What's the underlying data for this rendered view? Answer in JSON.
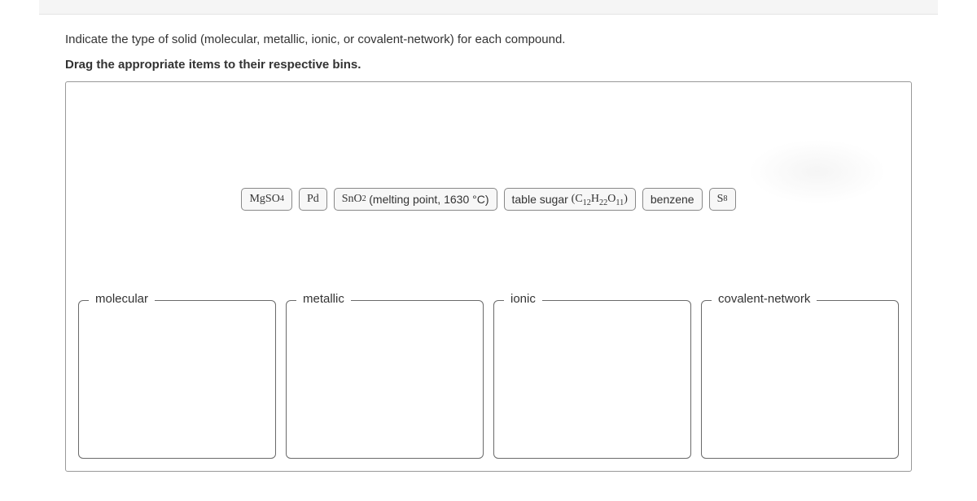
{
  "question": "Indicate the type of solid (molecular, metallic, ionic, or covalent-network) for each compound.",
  "instruction": "Drag the appropriate items to their respective bins.",
  "items": [
    {
      "formula": "MgSO4",
      "display_html": "MgSO<sub>4</sub>"
    },
    {
      "formula": "Pd",
      "display_html": "Pd"
    },
    {
      "formula": "SnO2 (melting point, 1630 °C)",
      "display_html": "SnO<sub>2</sub> (melting point, 1630 °C)"
    },
    {
      "formula": "table sugar (C12H22O11)",
      "display_html": "table sugar (C<sub>12</sub>H<sub>22</sub>O<sub>11</sub>)"
    },
    {
      "formula": "benzene",
      "display_html": "benzene"
    },
    {
      "formula": "S8",
      "display_html": "S<sub>8</sub>"
    }
  ],
  "bins": [
    {
      "label": "molecular"
    },
    {
      "label": "metallic"
    },
    {
      "label": "ionic"
    },
    {
      "label": "covalent-network"
    }
  ]
}
